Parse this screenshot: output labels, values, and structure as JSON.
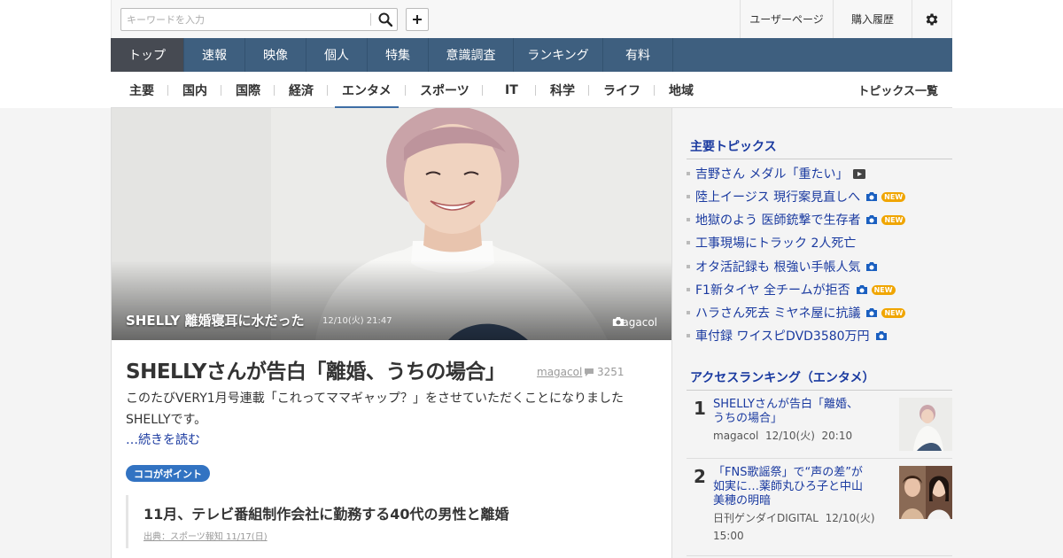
{
  "header": {
    "search_placeholder": "キーワードを入力",
    "user_page": "ユーザーページ",
    "purchase_history": "購入履歴"
  },
  "main_nav": [
    "トップ",
    "速報",
    "映像",
    "個人",
    "特集",
    "意識調査",
    "ランキング",
    "有料"
  ],
  "sub_nav": [
    "主要",
    "国内",
    "国際",
    "経済",
    "エンタメ",
    "スポーツ",
    "IT",
    "科学",
    "ライフ",
    "地域"
  ],
  "sub_nav_active": "エンタメ",
  "topics_all": "トピックス一覧",
  "hero": {
    "caption": "SHELLY 離婚寝耳に水だった",
    "time": "12/10(火) 21:47",
    "credit": "magacol"
  },
  "article": {
    "title": "SHELLYさんが告白「離婚、うちの場合」",
    "source": "magacol",
    "comments": "3251",
    "summary": "このたびVERY1月号連載「これってママギャップ？」をさせていただくことになりましたSHELLYです。",
    "read_more": "…続きを読む",
    "point_badge": "ココがポイント",
    "point_text": "11月、テレビ番組制作会社に勤務する40代の男性と離婚",
    "point_source": "出典：スポーツ報知 11/17(日)"
  },
  "sidebar": {
    "topics_heading": "主要トピックス",
    "topics": [
      {
        "text": "吉野さん メダル「重たい」",
        "icon": "video-icon",
        "new": false
      },
      {
        "text": "陸上イージス 現行案見直しへ",
        "icon": "camera-icon",
        "new": true
      },
      {
        "text": "地獄のよう 医師銃撃で生存者",
        "icon": "camera-icon",
        "new": true
      },
      {
        "text": "工事現場にトラック 2人死亡",
        "icon": "",
        "new": false
      },
      {
        "text": "オタ活記録も 根強い手帳人気",
        "icon": "camera-icon",
        "new": false
      },
      {
        "text": "F1新タイヤ 全チームが拒否",
        "icon": "camera-icon",
        "new": true
      },
      {
        "text": "ハラさん死去 ミヤネ屋に抗議",
        "icon": "camera-icon",
        "new": true
      },
      {
        "text": "車付録 ワイスピDVD3580万円",
        "icon": "camera-icon",
        "new": false
      }
    ],
    "new_label": "NEW",
    "ranking_heading": "アクセスランキング（エンタメ）",
    "ranking": [
      {
        "rank": "1",
        "title": "SHELLYさんが告白「離婚、うちの場合」",
        "source": "magacol",
        "date": "12/10(火)",
        "time": "20:10"
      },
      {
        "rank": "2",
        "title": "「FNS歌謡祭」で“声の差”が如実に…薬師丸ひろ子と中山美穂の明暗",
        "source": "日刊ゲンダイDIGITAL",
        "date": "12/10(火)",
        "time": "15:00"
      }
    ]
  },
  "colors": {
    "nav_bg": "#3e5f7f",
    "nav_active": "#464a52",
    "link": "#1a3aa0",
    "badge": "#3273c2",
    "new_badge": "#f0a500"
  }
}
